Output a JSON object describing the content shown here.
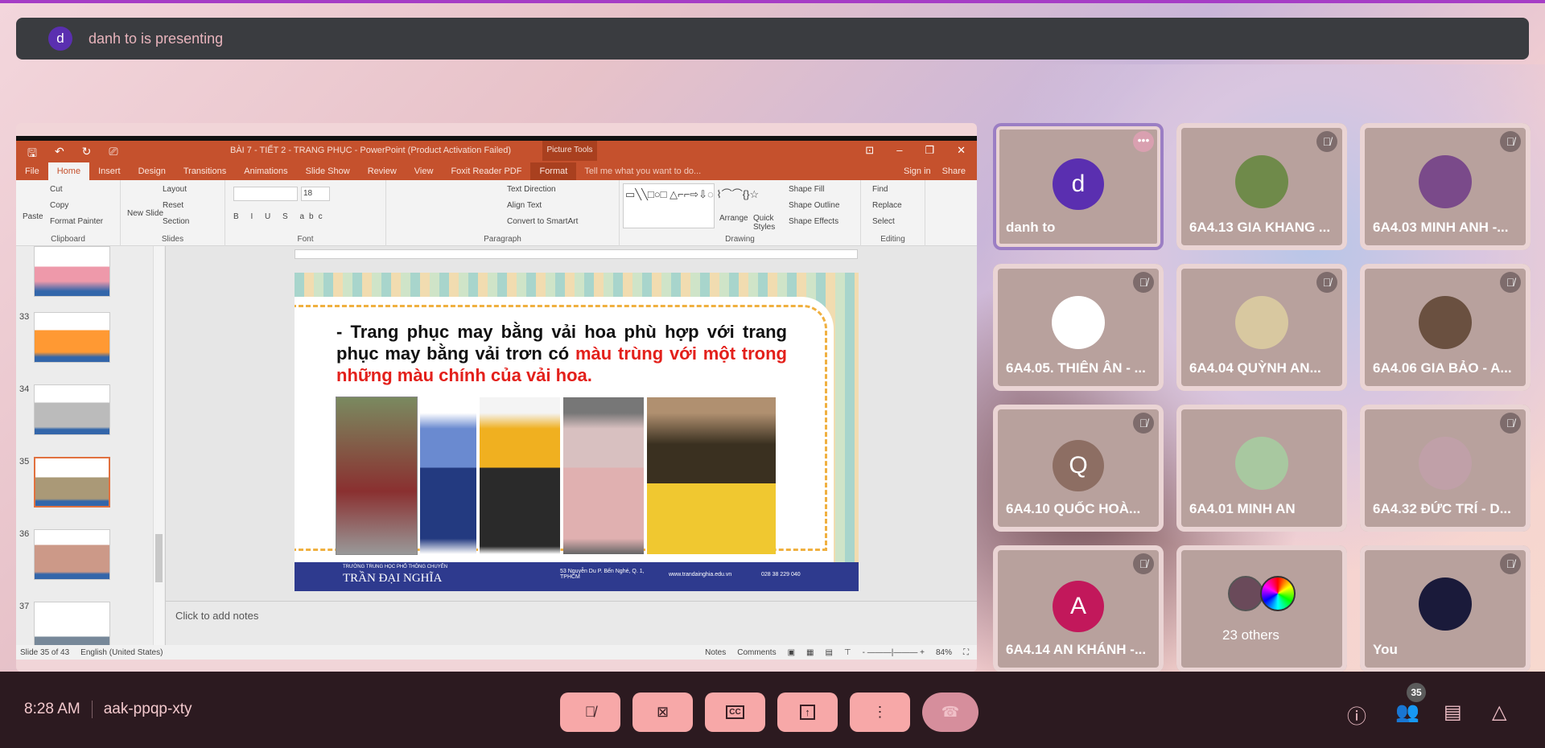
{
  "banner": {
    "avatar_letter": "d",
    "text": "danh to is presenting"
  },
  "ppt": {
    "title": "BÀI 7 - TIẾT 2 - TRANG PHỤC - PowerPoint (Product Activation Failed)",
    "picture_tools": "Picture Tools",
    "tabs": [
      "File",
      "Home",
      "Insert",
      "Design",
      "Transitions",
      "Animations",
      "Slide Show",
      "Review",
      "View",
      "Foxit Reader PDF",
      "Format"
    ],
    "tell_me": "Tell me what you want to do...",
    "sign_in": "Sign in",
    "share": "Share",
    "ribbon": {
      "clipboard": {
        "label": "Clipboard",
        "paste": "Paste",
        "cut": "Cut",
        "copy": "Copy",
        "format_painter": "Format Painter"
      },
      "slides": {
        "label": "Slides",
        "new_slide": "New Slide",
        "layout": "Layout",
        "reset": "Reset",
        "section": "Section"
      },
      "font": {
        "label": "Font",
        "size": "18"
      },
      "paragraph": {
        "label": "Paragraph",
        "text_direction": "Text Direction",
        "align_text": "Align Text",
        "convert": "Convert to SmartArt"
      },
      "drawing": {
        "label": "Drawing",
        "arrange": "Arrange",
        "quick_styles": "Quick Styles",
        "shape_fill": "Shape Fill",
        "shape_outline": "Shape Outline",
        "shape_effects": "Shape Effects"
      },
      "editing": {
        "label": "Editing",
        "find": "Find",
        "replace": "Replace",
        "select": "Select"
      }
    },
    "thumbs": [
      {
        "num": ""
      },
      {
        "num": "33"
      },
      {
        "num": "34"
      },
      {
        "num": "35"
      },
      {
        "num": "36"
      },
      {
        "num": "37"
      }
    ],
    "slide": {
      "text_black": "- Trang phục may bằng vải hoa phù hợp với trang phục may bằng vải trơn có ",
      "text_red": "màu trùng với một trong những màu chính của vải hoa.",
      "school_small": "TRƯỜNG TRUNG HỌC PHỔ THÔNG CHUYÊN",
      "school": "TRẦN ĐẠI NGHĨA",
      "address": "53 Nguyễn Du P. Bến Nghé, Q. 1, TPHCM",
      "web": "www.trandainghia.edu.vn",
      "phone": "028 38 229 040"
    },
    "notes_placeholder": "Click to add notes",
    "status": {
      "slide": "Slide 35 of 43",
      "lang": "English (United States)",
      "notes": "Notes",
      "comments": "Comments",
      "zoom": "84%"
    }
  },
  "participants": [
    {
      "name": "danh to",
      "letter": "d",
      "color": "#5a2fb0",
      "presenter": true
    },
    {
      "name": "6A4.13 GIA KHANG ...",
      "color": "#6f8a4a",
      "muted": true
    },
    {
      "name": "6A4.03 MINH ANH -...",
      "color": "#7a4a8a",
      "muted": true
    },
    {
      "name": "6A4.05. THIÊN ÂN - ...",
      "color": "#ffffff",
      "muted": true
    },
    {
      "name": "6A4.04 QUỲNH AN...",
      "color": "#d8c8a0",
      "muted": true
    },
    {
      "name": "6A4.06 GIA BẢO - A...",
      "color": "#6a5040",
      "muted": true
    },
    {
      "name": "6A4.10 QUỐC HOÀ...",
      "letter": "Q",
      "color": "#8d6e63",
      "muted": true
    },
    {
      "name": "6A4.01 MINH AN",
      "color": "#a8c8a0",
      "muted": false
    },
    {
      "name": "6A4.32 ĐỨC TRÍ - D...",
      "color": "#c0a0a8",
      "muted": true
    },
    {
      "name": "6A4.14 AN KHÁNH -...",
      "letter": "A",
      "color": "#c2185b",
      "muted": true
    },
    {
      "name": "23 others",
      "color": "#404040",
      "muted": false
    },
    {
      "name": "You",
      "color": "#1a1a3a",
      "muted": true
    }
  ],
  "bottom": {
    "time": "8:28 AM",
    "meeting_code": "aak-ppqp-xty",
    "people_count": "35"
  }
}
